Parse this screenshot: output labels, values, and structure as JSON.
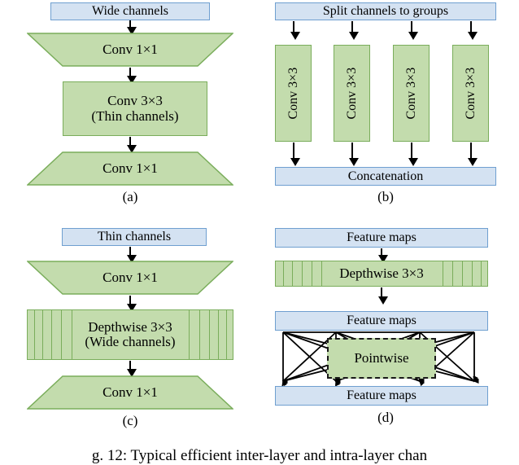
{
  "figure": {
    "caption": "g. 12: Typical efficient inter-layer and intra-layer chan"
  },
  "panels": [
    {
      "id": "a",
      "label": "(a)",
      "title": "Inverted-free bottleneck block",
      "nodes": [
        {
          "name": "input-banner",
          "text": "Wide channels",
          "shape": "rect-blue"
        },
        {
          "name": "conv-1x1-top",
          "text": "Conv 1×1",
          "shape": "trapezoid-down"
        },
        {
          "name": "conv-3x3",
          "text": "Conv 3×3",
          "text2": "(Thin channels)",
          "shape": "rect-green"
        },
        {
          "name": "conv-1x1-bottom",
          "text": "Conv 1×1",
          "shape": "trapezoid-up"
        }
      ]
    },
    {
      "id": "b",
      "label": "(b)",
      "title": "Grouped convolution",
      "nodes": [
        {
          "name": "split-banner",
          "text": "Split channels to groups",
          "shape": "rect-blue"
        },
        {
          "name": "group-conv-1",
          "text": "Conv 3×3",
          "shape": "rect-green-vertical"
        },
        {
          "name": "group-conv-2",
          "text": "Conv 3×3",
          "shape": "rect-green-vertical"
        },
        {
          "name": "group-conv-3",
          "text": "Conv 3×3",
          "shape": "rect-green-vertical"
        },
        {
          "name": "group-conv-4",
          "text": "Conv 3×3",
          "shape": "rect-green-vertical"
        },
        {
          "name": "concat-banner",
          "text": "Concatenation",
          "shape": "rect-blue"
        }
      ]
    },
    {
      "id": "c",
      "label": "(c)",
      "title": "Inverted bottleneck block",
      "nodes": [
        {
          "name": "input-banner",
          "text": "Thin channels",
          "shape": "rect-blue"
        },
        {
          "name": "conv-1x1-top",
          "text": "Conv 1×1",
          "shape": "trapezoid-down"
        },
        {
          "name": "depthwise-3x3",
          "text": "Depthwise 3×3",
          "text2": "(Wide channels)",
          "shape": "rect-green-striped"
        },
        {
          "name": "conv-1x1-bottom",
          "text": "Conv 1×1",
          "shape": "trapezoid-up"
        }
      ]
    },
    {
      "id": "d",
      "label": "(d)",
      "title": "Depthwise separable convolution",
      "nodes": [
        {
          "name": "feature-maps-top",
          "text": "Feature maps",
          "shape": "rect-blue"
        },
        {
          "name": "depthwise-3x3",
          "text": "Depthwise 3×3",
          "shape": "rect-green-striped"
        },
        {
          "name": "feature-maps-middle",
          "text": "Feature maps",
          "shape": "rect-blue"
        },
        {
          "name": "pointwise",
          "text": "Pointwise",
          "shape": "rect-green-dashed"
        },
        {
          "name": "feature-maps-bottom",
          "text": "Feature maps",
          "shape": "rect-blue"
        }
      ]
    }
  ],
  "colors": {
    "blue_fill": "#d4e2f2",
    "blue_border": "#6f9fd0",
    "green_fill": "#c3dcad",
    "green_border": "#7aad5b",
    "line": "#000000",
    "background": "#ffffff"
  }
}
